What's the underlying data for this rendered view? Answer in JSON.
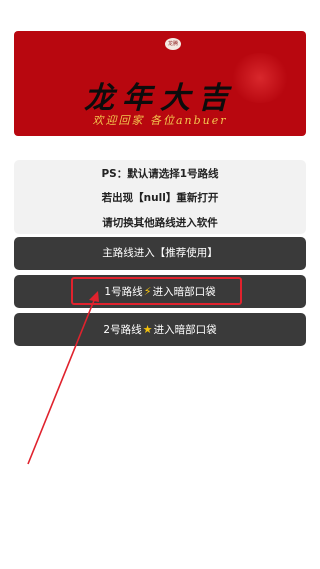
{
  "banner": {
    "seal_text": "龙腾",
    "title": "龙年大吉",
    "subtitle": "欢迎回家 各位anbuer"
  },
  "notice": {
    "line1": "PS：默认请选择1号路线",
    "line2": "若出现【null】重新打开",
    "line3": "请切换其他路线进入软件"
  },
  "routes": [
    {
      "label": "主路线进入【推荐使用】"
    },
    {
      "prefix": "1号路线",
      "icon": "⚡",
      "suffix": "进入暗部口袋"
    },
    {
      "prefix": "2号路线",
      "icon": "★",
      "suffix": "进入暗部口袋"
    }
  ],
  "annotation": {
    "highlight_color": "#e0222d",
    "arrow_color": "#e0222d"
  }
}
